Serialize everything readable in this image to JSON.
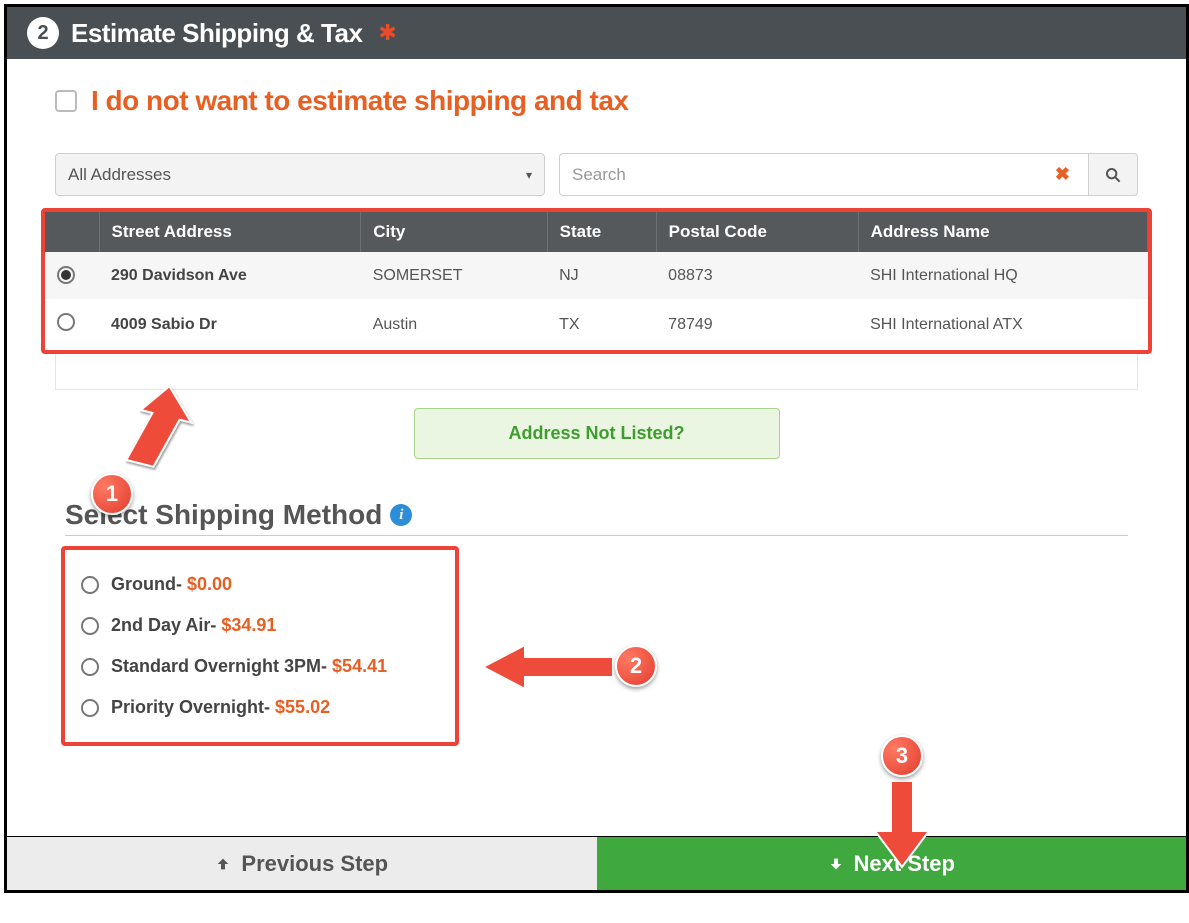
{
  "header": {
    "step_number": "2",
    "title": "Estimate Shipping & Tax"
  },
  "opt_out": {
    "label": "I do not want to estimate shipping and tax"
  },
  "filter": {
    "selected": "All Addresses"
  },
  "search": {
    "placeholder": "Search"
  },
  "table": {
    "headers": {
      "street": "Street Address",
      "city": "City",
      "state": "State",
      "postal": "Postal Code",
      "name": "Address Name"
    },
    "rows": [
      {
        "selected": true,
        "street": "290 Davidson Ave",
        "city": "SOMERSET",
        "state": "NJ",
        "postal": "08873",
        "name": "SHI International HQ"
      },
      {
        "selected": false,
        "street": "4009 Sabio Dr",
        "city": "Austin",
        "state": "TX",
        "postal": "78749",
        "name": "SHI International ATX"
      }
    ]
  },
  "not_listed": {
    "label": "Address Not Listed?"
  },
  "shipping": {
    "heading": "Select Shipping Method",
    "options": [
      {
        "label": "Ground",
        "price": "$0.00"
      },
      {
        "label": "2nd Day Air",
        "price": "$34.91"
      },
      {
        "label": "Standard Overnight 3PM",
        "price": "$54.41"
      },
      {
        "label": "Priority Overnight",
        "price": "$55.02"
      }
    ]
  },
  "footer": {
    "prev": "Previous Step",
    "next": "Next Step"
  },
  "callouts": {
    "c1": "1",
    "c2": "2",
    "c3": "3"
  }
}
